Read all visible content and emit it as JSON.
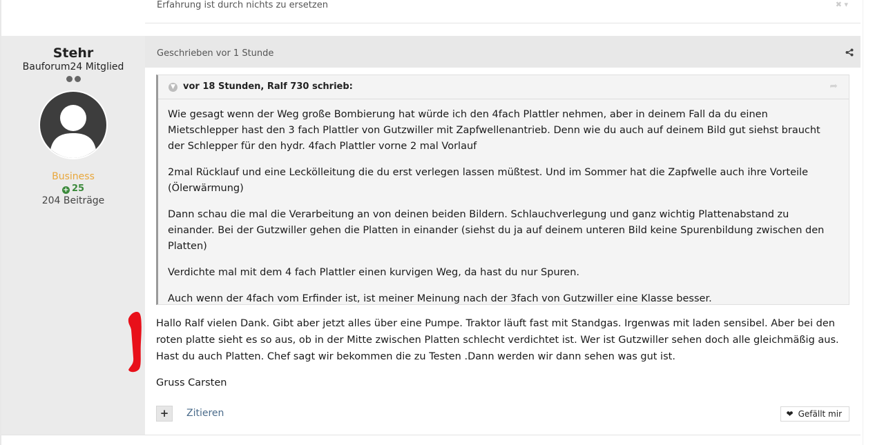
{
  "previous_post": {
    "text": "Erfahrung ist durch nichts zu ersetzen",
    "controls": "✖ ▾"
  },
  "author": {
    "name": "Stehr",
    "group": "Bauforum24 Mitglied",
    "title": "Business",
    "reputation": "25",
    "post_count": "204 Beiträge"
  },
  "post": {
    "date": "Geschrieben vor 1 Stunde",
    "quote": {
      "citation": "vor 18 Stunden, Ralf 730 schrieb:",
      "paragraphs": [
        "Wie gesagt wenn der Weg große Bombierung hat würde ich den 4fach Plattler nehmen, aber in deinem Fall da du einen Mietschlepper hast den 3 fach Plattler von Gutzwiller mit Zapfwellenantrieb. Denn wie du auch auf deinem Bild gut siehst braucht der Schlepper für den hydr. 4fach Plattler vorne 2 mal Vorlauf",
        "2mal Rücklauf und eine Leckölleitung die du erst verlegen lassen müßtest. Und im Sommer hat die Zapfwelle auch ihre Vorteile (Ölerwärmung)",
        "Dann schau die mal die Verarbeitung an von deinen beiden Bildern. Schlauchverlegung und ganz wichtig Plattenabstand zu einander. Bei der Gutzwiller gehen die Platten in einander (siehst du ja auf deinem unteren Bild keine Spurenbildung zwischen den Platten)",
        "Verdichte mal mit dem 4 fach Plattler einen kurvigen Weg, da hast du nur Spuren.",
        "Auch wenn der 4fach vom Erfinder ist, ist  meiner Meinung nach der 3fach von Gutzwiller eine Klasse besser."
      ]
    },
    "reply": [
      "Hallo Ralf vielen Dank.   Gibt aber jetzt alles über eine Pumpe. Traktor läuft fast mit Standgas. Irgenwas mit laden sensibel. Aber bei den roten platte sieht es so aus, ob in der Mitte zwischen Platten schlecht verdichtet ist. Wer ist Gutzwiller sehen doch alle gleichmäßig aus. Hast du auch Platten. Chef sagt wir bekommen die zu Testen .Dann werden wir dann sehen was gut ist.",
      "Gruss Carsten"
    ]
  },
  "actions": {
    "multiquote": "+",
    "quote": "Zitieren",
    "like": "Gefällt mir"
  },
  "colors": {
    "author_title": "#e9a73b",
    "reputation": "#3c8a3c",
    "link": "#4a6b8a",
    "red_mark": "#e8101a"
  },
  "icons": {
    "share": "share-icon",
    "toggle": "chevron-down-icon",
    "jump": "reply-arrow-icon",
    "like": "heart-icon",
    "reputation": "plus-circle-icon"
  }
}
